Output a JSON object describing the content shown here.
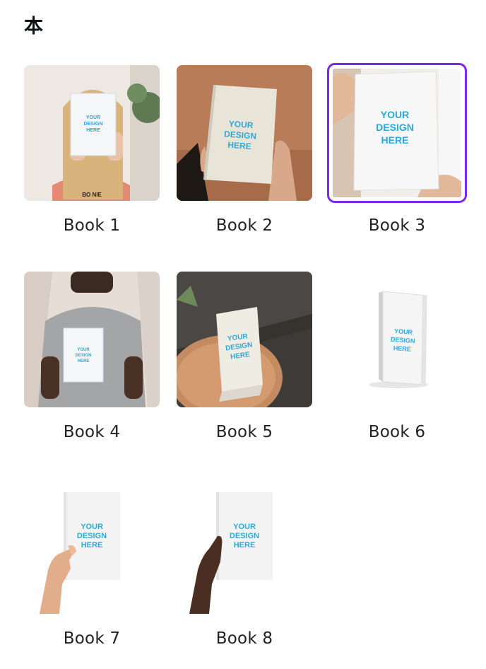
{
  "section": {
    "title": "本"
  },
  "cover_text": [
    "YOUR",
    "DESIGN",
    "HERE"
  ],
  "accent_color": "#7d2ae8",
  "items": [
    {
      "label": "Book 1",
      "selected": false,
      "shirt_text": "BO NIE"
    },
    {
      "label": "Book 2",
      "selected": false
    },
    {
      "label": "Book 3",
      "selected": true
    },
    {
      "label": "Book 4",
      "selected": false
    },
    {
      "label": "Book 5",
      "selected": false
    },
    {
      "label": "Book 6",
      "selected": false
    },
    {
      "label": "Book 7",
      "selected": false
    },
    {
      "label": "Book 8",
      "selected": false
    }
  ]
}
